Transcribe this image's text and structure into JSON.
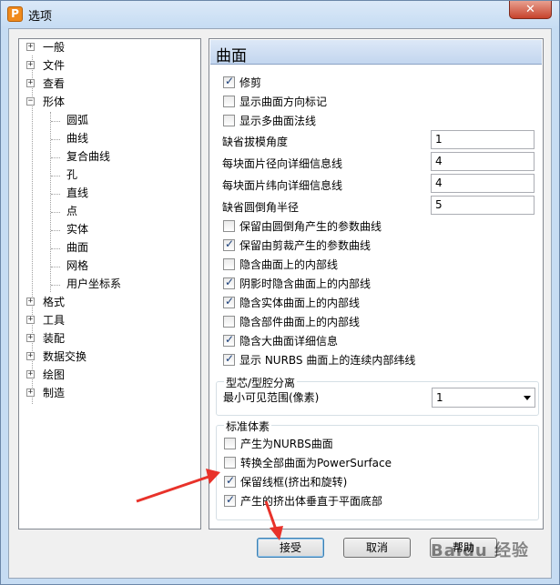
{
  "window": {
    "title": "选项",
    "app_icon_letter": "P",
    "close_glyph": "✕"
  },
  "tree": {
    "items": [
      {
        "label": "一般",
        "expander": "+"
      },
      {
        "label": "文件",
        "expander": "+"
      },
      {
        "label": "查看",
        "expander": "+"
      },
      {
        "label": "形体",
        "expander": "−"
      },
      {
        "label": "圆弧"
      },
      {
        "label": "曲线"
      },
      {
        "label": "复合曲线"
      },
      {
        "label": "孔"
      },
      {
        "label": "直线"
      },
      {
        "label": "点"
      },
      {
        "label": "实体"
      },
      {
        "label": "曲面"
      },
      {
        "label": "网格"
      },
      {
        "label": "用户坐标系"
      },
      {
        "label": "格式",
        "expander": "+"
      },
      {
        "label": "工具",
        "expander": "+"
      },
      {
        "label": "装配",
        "expander": "+"
      },
      {
        "label": "数据交换",
        "expander": "+"
      },
      {
        "label": "绘图",
        "expander": "+"
      },
      {
        "label": "制造",
        "expander": "+"
      }
    ]
  },
  "panel": {
    "title": "曲面",
    "checkboxes_top": [
      {
        "label": "修剪",
        "checked": true
      },
      {
        "label": "显示曲面方向标记",
        "checked": false
      },
      {
        "label": "显示多曲面法线",
        "checked": false
      }
    ],
    "fields": [
      {
        "label": "缺省拔模角度",
        "value": "1"
      },
      {
        "label": "每块面片径向详细信息线",
        "value": "4"
      },
      {
        "label": "每块面片纬向详细信息线",
        "value": "4"
      },
      {
        "label": "缺省圆倒角半径",
        "value": "5"
      }
    ],
    "checkboxes_mid": [
      {
        "label": "保留由圆倒角产生的参数曲线",
        "checked": false
      },
      {
        "label": "保留由剪裁产生的参数曲线",
        "checked": true
      },
      {
        "label": "隐含曲面上的内部线",
        "checked": false
      },
      {
        "label": "阴影时隐含曲面上的内部线",
        "checked": true
      },
      {
        "label": "隐含实体曲面上的内部线",
        "checked": true
      },
      {
        "label": "隐含部件曲面上的内部线",
        "checked": false
      },
      {
        "label": "隐含大曲面详细信息",
        "checked": true
      },
      {
        "label": "显示 NURBS 曲面上的连续内部纬线",
        "checked": true
      }
    ],
    "core_cavity": {
      "title": "型芯/型腔分离",
      "min_visible_label": "最小可见范围(像素)",
      "min_visible_value": "1"
    },
    "standard": {
      "title": "标准体素",
      "checkboxes": [
        {
          "label": "产生为NURBS曲面",
          "checked": false
        },
        {
          "label": "转换全部曲面为PowerSurface",
          "checked": false
        },
        {
          "label": "保留线框(挤出和旋转)",
          "checked": true
        },
        {
          "label": "产生的挤出体垂直于平面底部",
          "checked": true
        }
      ]
    }
  },
  "buttons": {
    "accept": "接受",
    "cancel": "取消",
    "help": "帮助"
  },
  "watermark": "Baidu 经验",
  "colors": {
    "arrow": "#e8322a",
    "header": "#c3d6ef",
    "check": "#1b3f7a"
  }
}
